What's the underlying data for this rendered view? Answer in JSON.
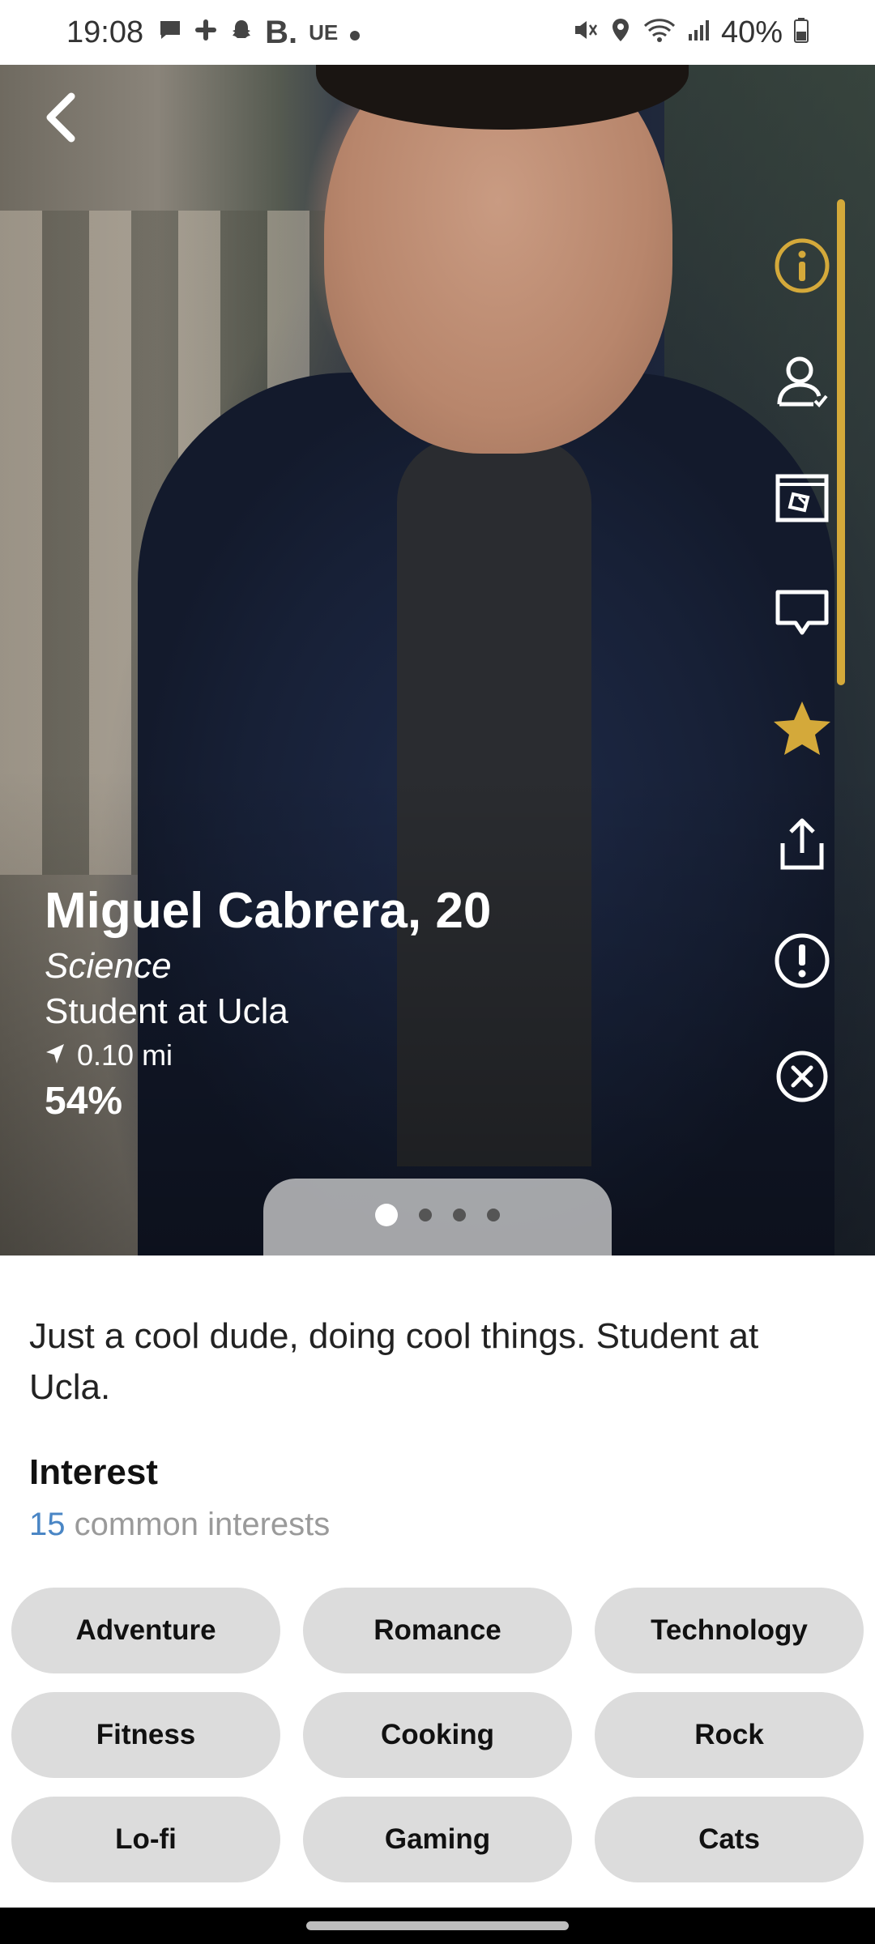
{
  "status_bar": {
    "time": "19:08",
    "left_icons": [
      "message-icon",
      "slack-icon",
      "snapchat-icon",
      "booking-icon",
      "ue-icon",
      "dot-icon"
    ],
    "b_label": "B.",
    "ue_label": "UE",
    "battery": "40%"
  },
  "profile": {
    "name_age": "Miguel Cabrera, 20",
    "major": "Science",
    "school": "Student at Ucla",
    "distance": "0.10 mi",
    "match": "54%"
  },
  "gallery": {
    "pages": 4,
    "current": 1
  },
  "side_actions": [
    {
      "name": "info-icon"
    },
    {
      "name": "profile-verified-icon"
    },
    {
      "name": "card-icon"
    },
    {
      "name": "chat-icon"
    },
    {
      "name": "star-icon"
    },
    {
      "name": "share-icon"
    },
    {
      "name": "report-icon"
    },
    {
      "name": "close-icon"
    }
  ],
  "bio": "Just a cool dude, doing cool things. Student at Ucla.",
  "interest": {
    "title": "Interest",
    "count": "15",
    "count_label": "common interests",
    "chips": [
      "Adventure",
      "Romance",
      "Technology",
      "Fitness",
      "Cooking",
      "Rock",
      "Lo-fi",
      "Gaming",
      "Cats"
    ]
  },
  "colors": {
    "accent_gold": "#d4a93a",
    "link_blue": "#4a86c5",
    "chip_bg": "#dcdcdc"
  }
}
